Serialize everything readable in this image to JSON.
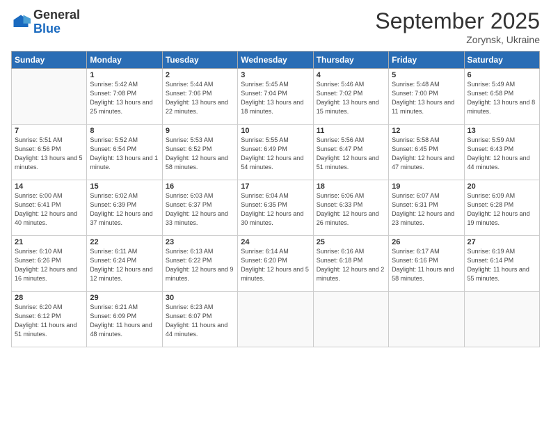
{
  "logo": {
    "general": "General",
    "blue": "Blue"
  },
  "title": "September 2025",
  "subtitle": "Zorynsk, Ukraine",
  "days_header": [
    "Sunday",
    "Monday",
    "Tuesday",
    "Wednesday",
    "Thursday",
    "Friday",
    "Saturday"
  ],
  "weeks": [
    [
      {
        "day": "",
        "sunrise": "",
        "sunset": "",
        "daylight": ""
      },
      {
        "day": "1",
        "sunrise": "Sunrise: 5:42 AM",
        "sunset": "Sunset: 7:08 PM",
        "daylight": "Daylight: 13 hours and 25 minutes."
      },
      {
        "day": "2",
        "sunrise": "Sunrise: 5:44 AM",
        "sunset": "Sunset: 7:06 PM",
        "daylight": "Daylight: 13 hours and 22 minutes."
      },
      {
        "day": "3",
        "sunrise": "Sunrise: 5:45 AM",
        "sunset": "Sunset: 7:04 PM",
        "daylight": "Daylight: 13 hours and 18 minutes."
      },
      {
        "day": "4",
        "sunrise": "Sunrise: 5:46 AM",
        "sunset": "Sunset: 7:02 PM",
        "daylight": "Daylight: 13 hours and 15 minutes."
      },
      {
        "day": "5",
        "sunrise": "Sunrise: 5:48 AM",
        "sunset": "Sunset: 7:00 PM",
        "daylight": "Daylight: 13 hours and 11 minutes."
      },
      {
        "day": "6",
        "sunrise": "Sunrise: 5:49 AM",
        "sunset": "Sunset: 6:58 PM",
        "daylight": "Daylight: 13 hours and 8 minutes."
      }
    ],
    [
      {
        "day": "7",
        "sunrise": "Sunrise: 5:51 AM",
        "sunset": "Sunset: 6:56 PM",
        "daylight": "Daylight: 13 hours and 5 minutes."
      },
      {
        "day": "8",
        "sunrise": "Sunrise: 5:52 AM",
        "sunset": "Sunset: 6:54 PM",
        "daylight": "Daylight: 13 hours and 1 minute."
      },
      {
        "day": "9",
        "sunrise": "Sunrise: 5:53 AM",
        "sunset": "Sunset: 6:52 PM",
        "daylight": "Daylight: 12 hours and 58 minutes."
      },
      {
        "day": "10",
        "sunrise": "Sunrise: 5:55 AM",
        "sunset": "Sunset: 6:49 PM",
        "daylight": "Daylight: 12 hours and 54 minutes."
      },
      {
        "day": "11",
        "sunrise": "Sunrise: 5:56 AM",
        "sunset": "Sunset: 6:47 PM",
        "daylight": "Daylight: 12 hours and 51 minutes."
      },
      {
        "day": "12",
        "sunrise": "Sunrise: 5:58 AM",
        "sunset": "Sunset: 6:45 PM",
        "daylight": "Daylight: 12 hours and 47 minutes."
      },
      {
        "day": "13",
        "sunrise": "Sunrise: 5:59 AM",
        "sunset": "Sunset: 6:43 PM",
        "daylight": "Daylight: 12 hours and 44 minutes."
      }
    ],
    [
      {
        "day": "14",
        "sunrise": "Sunrise: 6:00 AM",
        "sunset": "Sunset: 6:41 PM",
        "daylight": "Daylight: 12 hours and 40 minutes."
      },
      {
        "day": "15",
        "sunrise": "Sunrise: 6:02 AM",
        "sunset": "Sunset: 6:39 PM",
        "daylight": "Daylight: 12 hours and 37 minutes."
      },
      {
        "day": "16",
        "sunrise": "Sunrise: 6:03 AM",
        "sunset": "Sunset: 6:37 PM",
        "daylight": "Daylight: 12 hours and 33 minutes."
      },
      {
        "day": "17",
        "sunrise": "Sunrise: 6:04 AM",
        "sunset": "Sunset: 6:35 PM",
        "daylight": "Daylight: 12 hours and 30 minutes."
      },
      {
        "day": "18",
        "sunrise": "Sunrise: 6:06 AM",
        "sunset": "Sunset: 6:33 PM",
        "daylight": "Daylight: 12 hours and 26 minutes."
      },
      {
        "day": "19",
        "sunrise": "Sunrise: 6:07 AM",
        "sunset": "Sunset: 6:31 PM",
        "daylight": "Daylight: 12 hours and 23 minutes."
      },
      {
        "day": "20",
        "sunrise": "Sunrise: 6:09 AM",
        "sunset": "Sunset: 6:28 PM",
        "daylight": "Daylight: 12 hours and 19 minutes."
      }
    ],
    [
      {
        "day": "21",
        "sunrise": "Sunrise: 6:10 AM",
        "sunset": "Sunset: 6:26 PM",
        "daylight": "Daylight: 12 hours and 16 minutes."
      },
      {
        "day": "22",
        "sunrise": "Sunrise: 6:11 AM",
        "sunset": "Sunset: 6:24 PM",
        "daylight": "Daylight: 12 hours and 12 minutes."
      },
      {
        "day": "23",
        "sunrise": "Sunrise: 6:13 AM",
        "sunset": "Sunset: 6:22 PM",
        "daylight": "Daylight: 12 hours and 9 minutes."
      },
      {
        "day": "24",
        "sunrise": "Sunrise: 6:14 AM",
        "sunset": "Sunset: 6:20 PM",
        "daylight": "Daylight: 12 hours and 5 minutes."
      },
      {
        "day": "25",
        "sunrise": "Sunrise: 6:16 AM",
        "sunset": "Sunset: 6:18 PM",
        "daylight": "Daylight: 12 hours and 2 minutes."
      },
      {
        "day": "26",
        "sunrise": "Sunrise: 6:17 AM",
        "sunset": "Sunset: 6:16 PM",
        "daylight": "Daylight: 11 hours and 58 minutes."
      },
      {
        "day": "27",
        "sunrise": "Sunrise: 6:19 AM",
        "sunset": "Sunset: 6:14 PM",
        "daylight": "Daylight: 11 hours and 55 minutes."
      }
    ],
    [
      {
        "day": "28",
        "sunrise": "Sunrise: 6:20 AM",
        "sunset": "Sunset: 6:12 PM",
        "daylight": "Daylight: 11 hours and 51 minutes."
      },
      {
        "day": "29",
        "sunrise": "Sunrise: 6:21 AM",
        "sunset": "Sunset: 6:09 PM",
        "daylight": "Daylight: 11 hours and 48 minutes."
      },
      {
        "day": "30",
        "sunrise": "Sunrise: 6:23 AM",
        "sunset": "Sunset: 6:07 PM",
        "daylight": "Daylight: 11 hours and 44 minutes."
      },
      {
        "day": "",
        "sunrise": "",
        "sunset": "",
        "daylight": ""
      },
      {
        "day": "",
        "sunrise": "",
        "sunset": "",
        "daylight": ""
      },
      {
        "day": "",
        "sunrise": "",
        "sunset": "",
        "daylight": ""
      },
      {
        "day": "",
        "sunrise": "",
        "sunset": "",
        "daylight": ""
      }
    ]
  ]
}
